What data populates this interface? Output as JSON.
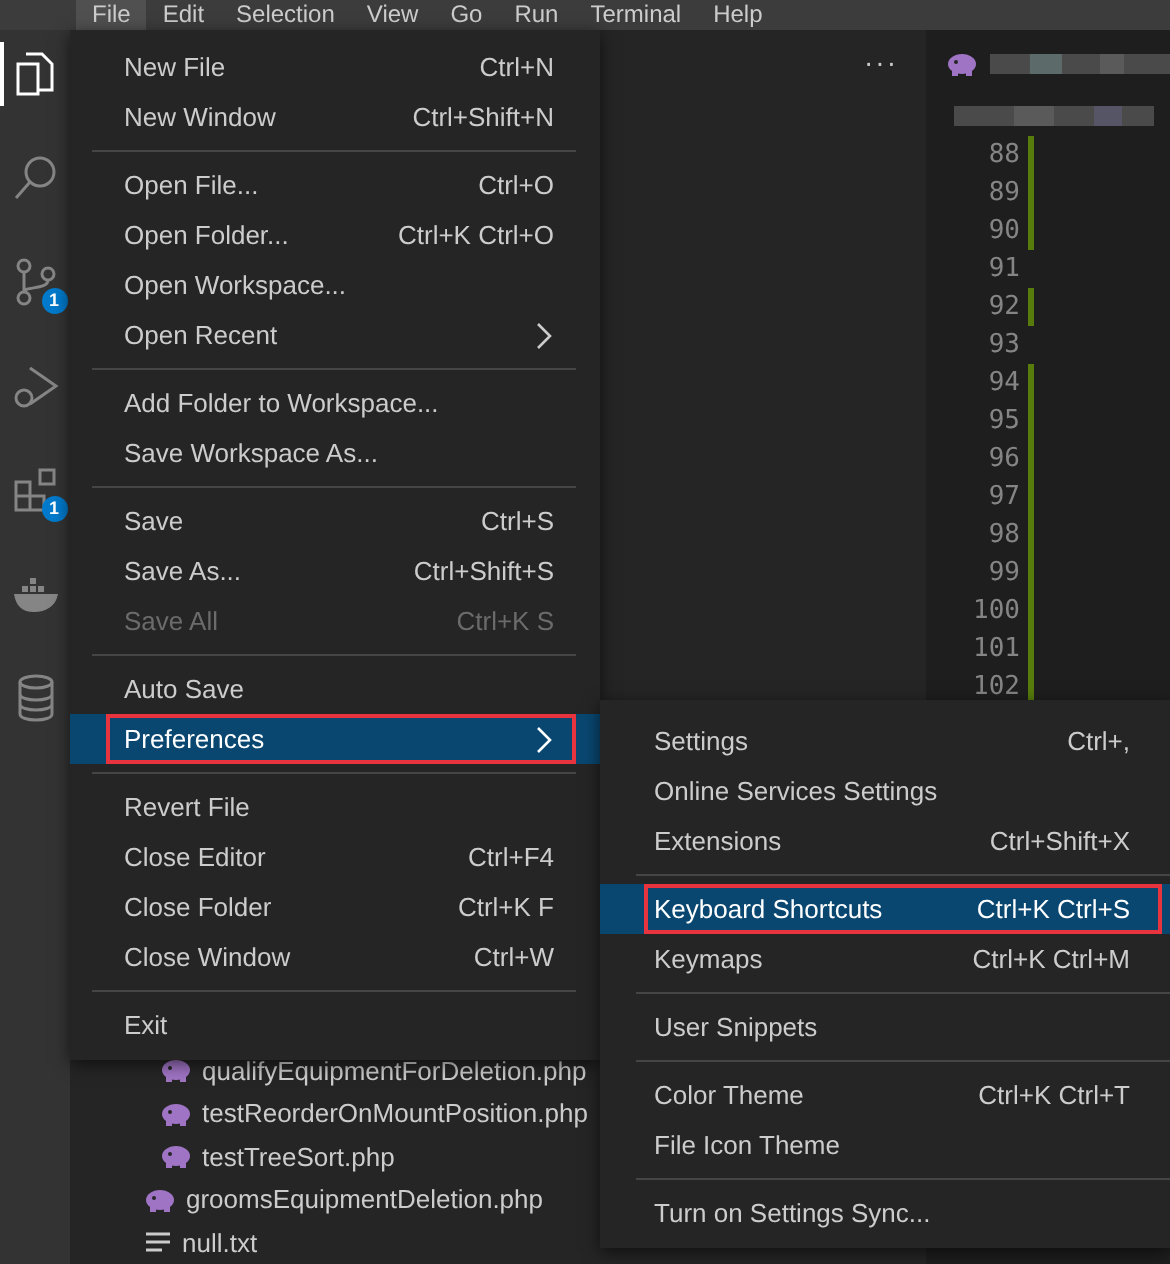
{
  "menubar": [
    {
      "label": "File",
      "selected": true
    },
    {
      "label": "Edit",
      "selected": false
    },
    {
      "label": "Selection",
      "selected": false
    },
    {
      "label": "View",
      "selected": false
    },
    {
      "label": "Go",
      "selected": false
    },
    {
      "label": "Run",
      "selected": false
    },
    {
      "label": "Terminal",
      "selected": false
    },
    {
      "label": "Help",
      "selected": false
    }
  ],
  "activity_bar": [
    {
      "kind": "files",
      "selected": true
    },
    {
      "kind": "search",
      "selected": false
    },
    {
      "kind": "source-control",
      "selected": false,
      "badge": "1"
    },
    {
      "kind": "run",
      "selected": false
    },
    {
      "kind": "extensions",
      "selected": false,
      "badge": "1"
    },
    {
      "kind": "docker",
      "selected": false
    },
    {
      "kind": "database",
      "selected": false
    }
  ],
  "sidebar": {
    "more": "···",
    "tree": [
      {
        "children": [
          {
            "name": "qualifyEquipmentForDeletion.php",
            "kind": "php"
          },
          {
            "name": "testReorderOnMountPosition.php",
            "kind": "php"
          },
          {
            "name": "testTreeSort.php",
            "kind": "php"
          }
        ]
      },
      {
        "name": "groomsEquipmentDeletion.php",
        "kind": "php"
      },
      {
        "name": "null.txt",
        "kind": "text"
      }
    ]
  },
  "editor": {
    "tab": {
      "kind": "php"
    },
    "line_numbers": [
      {
        "number": "88",
        "changed": true
      },
      {
        "number": "89",
        "changed": true
      },
      {
        "number": "90",
        "changed": true
      },
      {
        "number": "91",
        "changed": false
      },
      {
        "number": "92",
        "changed": true
      },
      {
        "number": "93",
        "changed": false
      },
      {
        "number": "94",
        "changed": true
      },
      {
        "number": "95",
        "changed": true
      },
      {
        "number": "96",
        "changed": true
      },
      {
        "number": "97",
        "changed": true
      },
      {
        "number": "98",
        "changed": true
      },
      {
        "number": "99",
        "changed": true
      },
      {
        "number": "100",
        "changed": true
      },
      {
        "number": "101",
        "changed": true
      },
      {
        "number": "102",
        "changed": true
      }
    ]
  },
  "file_menu": {
    "groups": [
      [
        {
          "label": "New File",
          "shortcut": "Ctrl+N",
          "submenu": false,
          "disabled": false,
          "selected": false
        },
        {
          "label": "New Window",
          "shortcut": "Ctrl+Shift+N",
          "submenu": false,
          "disabled": false,
          "selected": false
        }
      ],
      [
        {
          "label": "Open File...",
          "shortcut": "Ctrl+O",
          "submenu": false,
          "disabled": false,
          "selected": false
        },
        {
          "label": "Open Folder...",
          "shortcut": "Ctrl+K Ctrl+O",
          "submenu": false,
          "disabled": false,
          "selected": false
        },
        {
          "label": "Open Workspace...",
          "submenu": false,
          "disabled": false,
          "selected": false
        },
        {
          "label": "Open Recent",
          "submenu": true,
          "disabled": false,
          "selected": false
        }
      ],
      [
        {
          "label": "Add Folder to Workspace...",
          "submenu": false,
          "disabled": false,
          "selected": false
        },
        {
          "label": "Save Workspace As...",
          "submenu": false,
          "disabled": false,
          "selected": false
        }
      ],
      [
        {
          "label": "Save",
          "shortcut": "Ctrl+S",
          "submenu": false,
          "disabled": false,
          "selected": false
        },
        {
          "label": "Save As...",
          "shortcut": "Ctrl+Shift+S",
          "submenu": false,
          "disabled": false,
          "selected": false
        },
        {
          "label": "Save All",
          "shortcut": "Ctrl+K S",
          "submenu": false,
          "disabled": true,
          "selected": false
        }
      ],
      [
        {
          "label": "Auto Save",
          "submenu": false,
          "disabled": false,
          "selected": false
        },
        {
          "label": "Preferences",
          "submenu": true,
          "disabled": false,
          "selected": true
        }
      ],
      [
        {
          "label": "Revert File",
          "submenu": false,
          "disabled": false,
          "selected": false
        },
        {
          "label": "Close Editor",
          "shortcut": "Ctrl+F4",
          "submenu": false,
          "disabled": false,
          "selected": false
        },
        {
          "label": "Close Folder",
          "shortcut": "Ctrl+K F",
          "submenu": false,
          "disabled": false,
          "selected": false
        },
        {
          "label": "Close Window",
          "shortcut": "Ctrl+W",
          "submenu": false,
          "disabled": false,
          "selected": false
        }
      ],
      [
        {
          "label": "Exit",
          "submenu": false,
          "disabled": false,
          "selected": false
        }
      ]
    ]
  },
  "preferences_menu": {
    "groups": [
      [
        {
          "label": "Settings",
          "shortcut": "Ctrl+,",
          "submenu": false,
          "disabled": false,
          "selected": false
        },
        {
          "label": "Online Services Settings",
          "submenu": false,
          "disabled": false,
          "selected": false
        },
        {
          "label": "Extensions",
          "shortcut": "Ctrl+Shift+X",
          "submenu": false,
          "disabled": false,
          "selected": false
        }
      ],
      [
        {
          "label": "Keyboard Shortcuts",
          "shortcut": "Ctrl+K Ctrl+S",
          "submenu": false,
          "disabled": false,
          "selected": true
        },
        {
          "label": "Keymaps",
          "shortcut": "Ctrl+K Ctrl+M",
          "submenu": false,
          "disabled": false,
          "selected": false
        }
      ],
      [
        {
          "label": "User Snippets",
          "submenu": false,
          "disabled": false,
          "selected": false
        }
      ],
      [
        {
          "label": "Color Theme",
          "shortcut": "Ctrl+K Ctrl+T",
          "submenu": false,
          "disabled": false,
          "selected": false
        },
        {
          "label": "File Icon Theme",
          "submenu": false,
          "disabled": false,
          "selected": false
        }
      ],
      [
        {
          "label": "Turn on Settings Sync...",
          "submenu": false,
          "disabled": false,
          "selected": false
        }
      ]
    ]
  }
}
